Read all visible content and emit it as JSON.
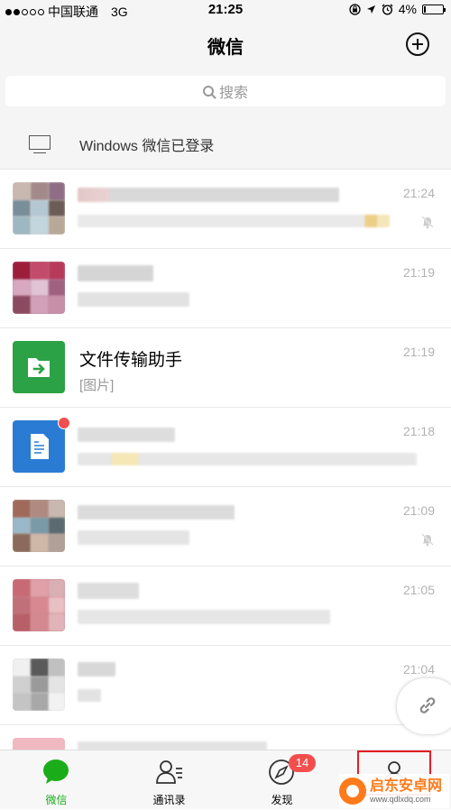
{
  "status_bar": {
    "carrier": "中国联通",
    "network": "3G",
    "time": "21:25",
    "battery": "4%"
  },
  "nav": {
    "title": "微信",
    "add_icon": "plus-circle-icon"
  },
  "search": {
    "placeholder": "搜索"
  },
  "login_notice": {
    "text": "Windows 微信已登录",
    "icon": "monitor-icon"
  },
  "chats": [
    {
      "name": "",
      "preview": "",
      "time": "21:24",
      "muted": true
    },
    {
      "name": "",
      "preview": "",
      "time": "21:19",
      "muted": false
    },
    {
      "name": "文件传输助手",
      "preview": "[图片]",
      "time": "21:19",
      "muted": false,
      "icon": "file-transfer-icon"
    },
    {
      "name": "",
      "preview": "",
      "time": "21:18",
      "muted": false,
      "unread_dot": true
    },
    {
      "name": "",
      "preview": "",
      "time": "21:09",
      "muted": true
    },
    {
      "name": "",
      "preview": "",
      "time": "21:05",
      "muted": false
    },
    {
      "name": "",
      "preview": "",
      "time": "21:04",
      "muted": false
    }
  ],
  "tabs": [
    {
      "label": "微信",
      "icon": "chat-bubble-icon",
      "active": true
    },
    {
      "label": "通讯录",
      "icon": "contacts-icon",
      "active": false
    },
    {
      "label": "发现",
      "icon": "compass-icon",
      "active": false,
      "badge": "14"
    },
    {
      "label": "",
      "icon": "me-icon",
      "active": false
    }
  ],
  "watermark": {
    "main": "启东安卓网",
    "sub": "www.qdlxdq.com"
  },
  "colors": {
    "wechat_green": "#1aad19",
    "badge_red": "#f34e4e",
    "highlight_box": "#e51c23"
  }
}
